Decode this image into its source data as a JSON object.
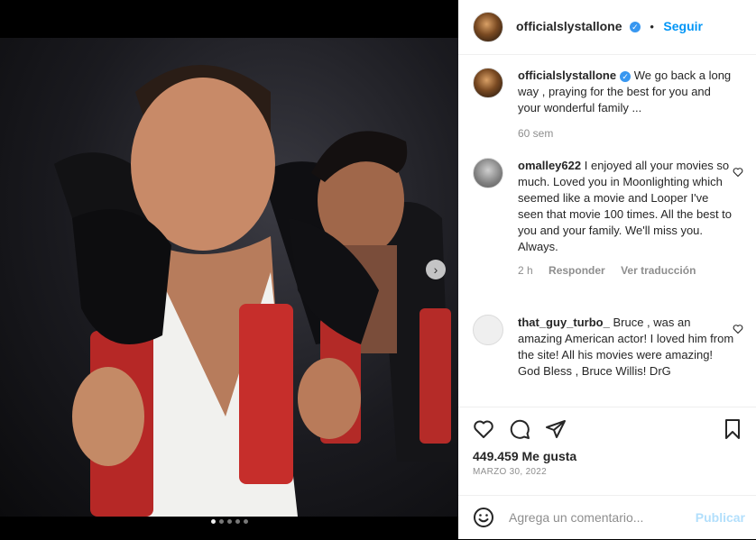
{
  "post": {
    "author": "officialslystallone",
    "follow_label": "Seguir",
    "caption": "We go back a long way , praying for the best for you and your wonderful family ...",
    "caption_time": "60 sem",
    "likes": "449.459 Me gusta",
    "date": "MARZO 30, 2022",
    "comment_placeholder": "Agrega un comentario...",
    "publish_label": "Publicar",
    "carousel": {
      "total": 5,
      "active": 1
    }
  },
  "comments": [
    {
      "user": "omalley622",
      "text": "I enjoyed all your movies so much. Loved you in Moonlighting which seemed like a movie and Looper I've seen that movie 100 times. All the best to you and your family. We'll miss you. Always.",
      "time": "2 h",
      "reply_label": "Responder",
      "translate_label": "Ver traducción"
    },
    {
      "user": "that_guy_turbo_",
      "text": "Bruce , was an amazing American actor! I loved him from the site! All his movies were amazing! God Bless , Bruce Willis! DrG"
    }
  ],
  "icons": {
    "like": "heart-icon",
    "comment": "comment-bubble-icon",
    "share": "paper-plane-icon",
    "save": "bookmark-icon",
    "emoji": "smiley-icon",
    "next": "chevron-right-icon",
    "verified": "verified-badge-icon"
  },
  "colors": {
    "link": "#0095f6",
    "verified": "#3897f0",
    "muted": "#8e8e8e"
  }
}
